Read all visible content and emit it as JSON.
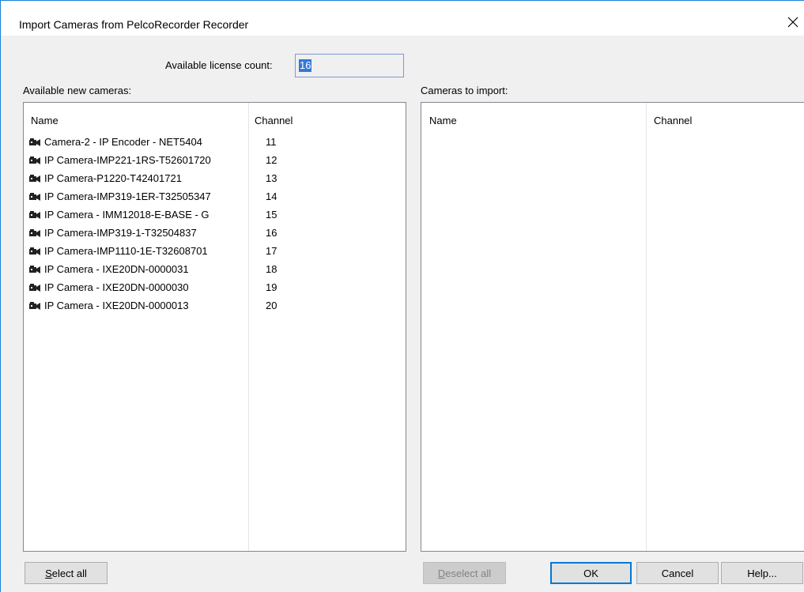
{
  "window": {
    "title": "Import Cameras from PelcoRecorder Recorder",
    "close_glyph": "✕"
  },
  "license": {
    "label": "Available license count:",
    "value": "16"
  },
  "available": {
    "label": "Available new cameras:",
    "columns": [
      "Name",
      "Channel"
    ],
    "rows": [
      {
        "name": "Camera-2 - IP Encoder - NET5404",
        "channel": "11"
      },
      {
        "name": "IP Camera-IMP221-1RS-T52601720",
        "channel": "12"
      },
      {
        "name": "IP Camera-P1220-T42401721",
        "channel": "13"
      },
      {
        "name": "IP Camera-IMP319-1ER-T32505347",
        "channel": "14"
      },
      {
        "name": "IP Camera - IMM12018-E-BASE - G",
        "channel": "15"
      },
      {
        "name": "IP Camera-IMP319-1-T32504837",
        "channel": "16"
      },
      {
        "name": "IP Camera-IMP1110-1E-T32608701",
        "channel": "17"
      },
      {
        "name": "IP Camera - IXE20DN-0000031",
        "channel": "18"
      },
      {
        "name": "IP Camera - IXE20DN-0000030",
        "channel": "19"
      },
      {
        "name": "IP Camera - IXE20DN-0000013",
        "channel": "20"
      }
    ],
    "row_icon": "camera-icon"
  },
  "to_import": {
    "label": "Cameras to import:",
    "columns": [
      "Name",
      "Channel"
    ],
    "rows": []
  },
  "buttons": {
    "select_all_u": "S",
    "select_all_rest": "elect all",
    "deselect_all_u": "D",
    "deselect_all_rest": "eselect all",
    "ok": "OK",
    "cancel": "Cancel",
    "help": "Help..."
  }
}
